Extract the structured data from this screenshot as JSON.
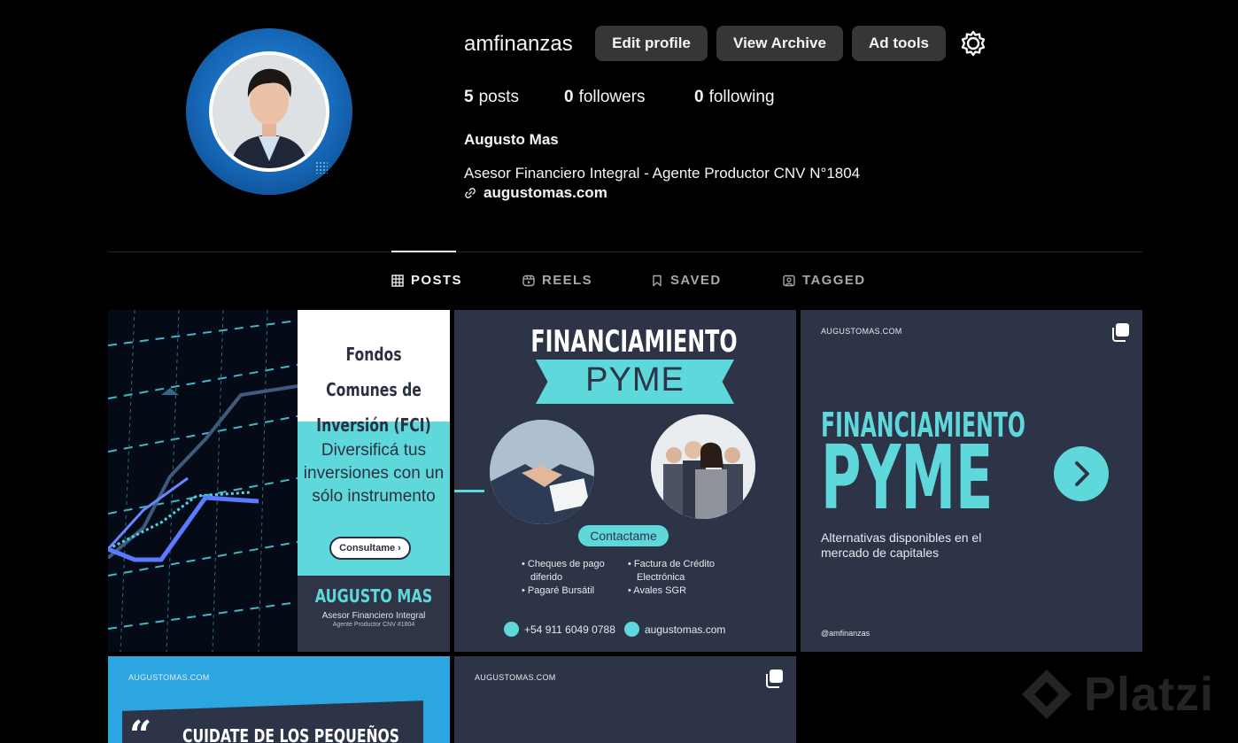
{
  "profile": {
    "username": "amfinanzas",
    "full_name": "Augusto Mas",
    "bio": "Asesor Financiero Integral - Agente Productor CNV N°1804",
    "link": "augustomas.com",
    "stats": {
      "posts_count": "5",
      "posts_label": "posts",
      "followers_count": "0",
      "followers_label": "followers",
      "following_count": "0",
      "following_label": "following"
    }
  },
  "actions": {
    "edit_profile": "Edit profile",
    "view_archive": "View Archive",
    "ad_tools": "Ad tools"
  },
  "tabs": [
    {
      "label": "POSTS",
      "icon": "grid-icon",
      "active": true
    },
    {
      "label": "REELS",
      "icon": "reels-icon",
      "active": false
    },
    {
      "label": "SAVED",
      "icon": "bookmark-icon",
      "active": false
    },
    {
      "label": "TAGGED",
      "icon": "tagged-icon",
      "active": false
    }
  ],
  "posts": {
    "p1": {
      "title": "Fondos Comunes de Inversión (FCI)",
      "body": "Diversificá tus inversiones con un sólo instrumento",
      "cta": "Consultame ›",
      "name": "AUGUSTO MAS",
      "role": "Asesor Financiero Integral",
      "license": "Agente Productor CNV #1804"
    },
    "p2": {
      "title": "FINANCIAMIENTO",
      "subtitle": "PYME",
      "cta": "Contactame",
      "bullets_left": [
        "• Cheques de pago",
        "  diferido",
        "• Pagaré Bursátil"
      ],
      "bullets_right": [
        "• Factura de Crédito",
        "  Electrónica",
        "• Avales SGR"
      ],
      "phone": "+54 911 6049 0788",
      "site": "augustomas.com"
    },
    "p3": {
      "site": "AUGUSTOMAS.COM",
      "title": "FINANCIAMIENTO",
      "subtitle": "PYME",
      "caption": "Alternativas disponibles en el mercado de capitales",
      "handle": "@amfinanzas"
    },
    "p4": {
      "site": "AUGUSTOMAS.COM",
      "quote_mark": "“",
      "headline": "CUIDATE DE LOS PEQUEÑOS"
    },
    "p5": {
      "site": "AUGUSTOMAS.COM"
    }
  },
  "watermark": "Platzi",
  "colors": {
    "background": "#000000",
    "button": "#363636",
    "accent_cyan": "#5fd8dc",
    "post_navy": "#2e3447",
    "avatar_ring": "#1668b8"
  }
}
